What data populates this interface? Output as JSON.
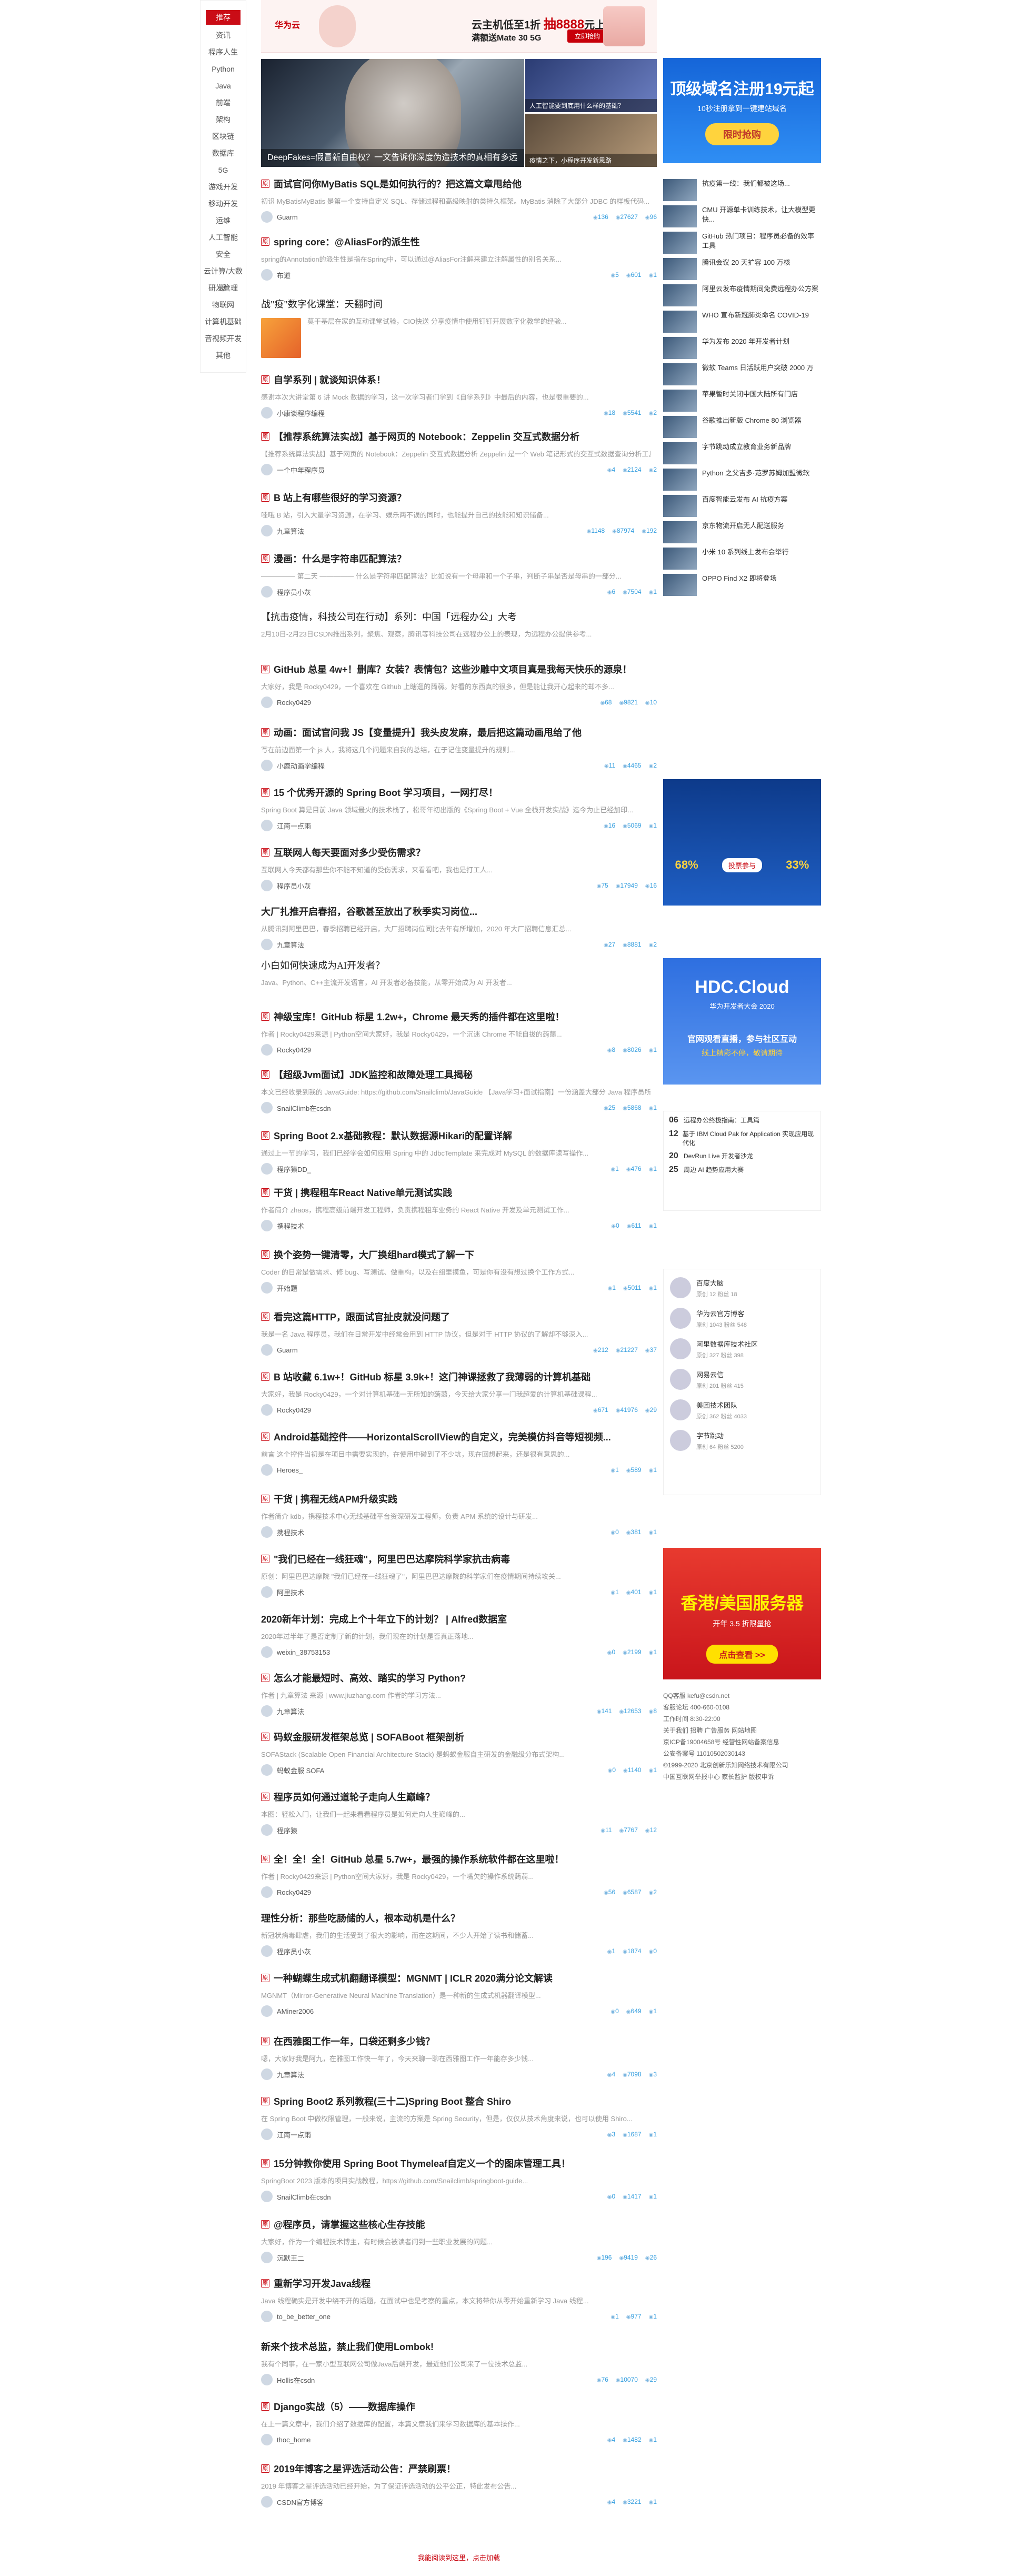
{
  "nav": [
    "推荐",
    "资讯",
    "程序人生",
    "Python",
    "Java",
    "前端",
    "架构",
    "区块链",
    "数据库",
    "5G",
    "游戏开发",
    "移动开发",
    "运维",
    "人工智能",
    "安全",
    "云计算/大数据",
    "研发管理",
    "物联网",
    "计算机基础",
    "音视频开发",
    "其他"
  ],
  "topad": {
    "brand": "华为云",
    "line1_pre": "云主机低至1折",
    "line1_price": "抽8888",
    "line1_post": "元上云礼包",
    "line2": "满额送Mate 30 5G",
    "button": "立即抢购"
  },
  "banner": {
    "main_caption": "DeepFakes=假冒新自由权？一文告诉你深度伪造技术的真相有多远",
    "side1": "人工智能要到底用什么样的基础？",
    "side2": "疫情之下，小程序开发新思路"
  },
  "articles": [
    {
      "title": "面试官问你MyBatis SQL是如何执行的？把这篇文章甩给他",
      "desc": "初识 MyBatisMyBatis 是第一个支持自定义 SQL、存储过程和高级映射的类持久框架。MyBatis 消除了大部分 JDBC 的样板代码...",
      "author": "Guarm",
      "likes": "136",
      "views": "27627",
      "comments": "96"
    },
    {
      "title": "spring core：@AliasFor的派生性",
      "desc": "spring的Annotation的派生性是指在Spring中，可以通过@AliasFor注解来建立注解属性的别名关系...",
      "author": "布道",
      "likes": "5",
      "views": "601",
      "comments": "1"
    },
    {
      "title": "战\"疫\"数字化课堂：天翻时间",
      "desc": "莫干基层在家的互动课堂试验，CIO快送 分享疫情中使用钉钉开展数字化教学的经验...",
      "author": "",
      "likes": "",
      "views": "",
      "comments": ""
    },
    {
      "title": "自学系列 | 就谈知识体系！",
      "desc": "感谢本次大讲堂第 6 讲 Mock 数据的学习，这一次学习者们学到《自学系列》中最后的内容，也是很重要的...",
      "author": "小康谈程序编程",
      "likes": "18",
      "views": "5541",
      "comments": "2"
    },
    {
      "title": "【推荐系统算法实战】基于网页的 Notebook：Zeppelin 交互式数据分析",
      "desc": "【推荐系统算法实战】基于网页的 Notebook：Zeppelin 交互式数据分析 Zeppelin 是一个 Web 笔记形式的交互式数据查询分析工具...",
      "author": "一个中年程序员",
      "likes": "4",
      "views": "2124",
      "comments": "2"
    },
    {
      "title": "B 站上有哪些很好的学习资源？",
      "desc": "哇哦 B 站，引入大量学习资源，在学习、娱乐两不误的同时，也能提升自己的技能和知识储备...",
      "author": "九章算法",
      "likes": "1148",
      "views": "87974",
      "comments": "192"
    },
    {
      "title": "漫画：什么是字符串匹配算法？",
      "desc": "—————  第二天  —————  什么是字符串匹配算法？比如说有一个母串和一个子串，判断子串是否是母串的一部分...",
      "author": "程序员小灰",
      "likes": "6",
      "views": "7504",
      "comments": "1"
    },
    {
      "title": "【抗击疫情，科技公司在行动】系列：中国「远程办公」大考",
      "desc": "2月10日-2月23日CSDN推出系列，聚焦、观察，腾讯等科技公司在远程办公上的表现，为远程办公提供参考...",
      "author": "",
      "likes": "",
      "views": "",
      "comments": ""
    },
    {
      "title": "GitHub 总星 4w+！删库？女装？表情包？这些沙雕中文项目真是我每天快乐的源泉！",
      "desc": "大家好，我是 Rocky0429，一个喜欢在 Github 上瞎逛的蒟蒻。好看的东西真的很多，但是能让我开心起来的却不多...",
      "author": "Rocky0429",
      "likes": "68",
      "views": "9821",
      "comments": "10"
    },
    {
      "title": "动画：面试官问我 JS【变量提升】我头皮发麻，最后把这篇动画甩给了他",
      "desc": "写在前边面第一个 js 人，我将这几个问题来自我的总结，在于记住变量提升的规则...",
      "author": "小鹿动画学编程",
      "likes": "11",
      "views": "4465",
      "comments": "2"
    },
    {
      "title": "15 个优秀开源的 Spring Boot 学习项目，一网打尽！",
      "desc": "Spring Boot 算是目前 Java 领域最火的技术栈了，松哥年初出版的《Spring Boot + Vue 全栈开发实战》迄今为止已经加印...",
      "author": "江南一点雨",
      "likes": "16",
      "views": "5069",
      "comments": "1"
    },
    {
      "title": "互联网人每天要面对多少受伤需求？",
      "desc": "互联网人今天都有那些你不能不知道的受伤需求，来看看吧，我也是打工人...",
      "author": "程序员小灰",
      "likes": "75",
      "views": "17949",
      "comments": "16"
    },
    {
      "title": "大厂扎推开启春招，谷歌甚至放出了秋季实习岗位...",
      "desc": "从腾讯到阿里巴巴，春季招聘已经开启，大厂招聘岗位同比去年有所增加，2020 年大厂招聘信息汇总...",
      "author": "九章算法",
      "likes": "27",
      "views": "8881",
      "comments": "2"
    },
    {
      "title": "小白如何快速成为AI开发者？",
      "desc": "Java、Python、C++主流开发语言，AI 开发者必备技能，从零开始成为 AI 开发者...",
      "author": "",
      "likes": "",
      "views": "",
      "comments": ""
    },
    {
      "title": "神级宝库！GitHub 标星 1.2w+，Chrome 最天秀的插件都在这里啦！",
      "desc": "作者 | Rocky0429来源 | Python空间大家好，我是 Rocky0429，一个沉迷 Chrome 不能自拔的蒟蒻...",
      "author": "Rocky0429",
      "likes": "8",
      "views": "8026",
      "comments": "1"
    },
    {
      "title": "【超级Jvm面试】JDK监控和故障处理工具揭秘",
      "desc": "本文已经收录到我的 JavaGuide: https://github.com/Snailclimb/JavaGuide 【Java学习+面试指南】一份涵盖大部分 Java 程序员所需要掌握的核心知识...",
      "author": "SnailClimb在csdn",
      "likes": "25",
      "views": "5868",
      "comments": "1"
    },
    {
      "title": "Spring Boot 2.x基础教程：默认数据源Hikari的配置详解",
      "desc": "通过上一节的学习，我们已经学会如何应用 Spring 中的 JdbcTemplate 来完成对 MySQL 的数据库读写操作...",
      "author": "程序猿DD_",
      "likes": "1",
      "views": "476",
      "comments": "1"
    },
    {
      "title": "干货 | 携程租车React Native单元测试实践",
      "desc": "作者简介 zhaos，携程高级前端开发工程师，负责携程租车业务的 React Native 开发及单元测试工作...",
      "author": "携程技术",
      "likes": "0",
      "views": "611",
      "comments": "1"
    },
    {
      "title": "换个姿势一键清零，大厂换组hard模式了解一下",
      "desc": "Coder 的日常是做需求、修 bug、写测试、做重构，以及在组里摸鱼，可是你有没有想过换个工作方式...",
      "author": "开始题",
      "likes": "1",
      "views": "5011",
      "comments": "1"
    },
    {
      "title": "看完这篇HTTP，跟面试官扯皮就没问题了",
      "desc": "我是一名 Java 程序员，我们在日常开发中经常会用到 HTTP 协议，但是对于 HTTP 协议的了解却不够深入...",
      "author": "Guarm",
      "likes": "212",
      "views": "21227",
      "comments": "37"
    },
    {
      "title": "B 站收藏 6.1w+！GitHub 标星 3.9k+！这门神课拯救了我薄弱的计算机基础",
      "desc": "大家好，我是 Rocky0429，一个对计算机基础一无所知的蒟蒻，今天给大家分享一门我超爱的计算机基础课程...",
      "author": "Rocky0429",
      "likes": "671",
      "views": "41976",
      "comments": "29"
    },
    {
      "title": "Android基础控件——HorizontalScrollView的自定义，完美模仿抖音等短视频...",
      "desc": "前言 这个控件当初是在项目中需要实现的，在使用中碰到了不少坑，现在回想起来，还是很有意思的...",
      "author": "Heroes_",
      "likes": "1",
      "views": "589",
      "comments": "1"
    },
    {
      "title": "干货 | 携程无线APM升级实践",
      "desc": "作者简介 kdb，携程技术中心无线基础平台资深研发工程师，负责 APM 系统的设计与研发...",
      "author": "携程技术",
      "likes": "0",
      "views": "381",
      "comments": "1"
    },
    {
      "title": "\"我们已经在一线狂魂\"，阿里巴巴达摩院科学家抗击病毒",
      "desc": "原创：阿里巴巴达摩院 \"我们已经在一线狂魂了\"，阿里巴巴达摩院的科学家们在疫情期间持续攻关...",
      "author": "阿里技术",
      "likes": "1",
      "views": "401",
      "comments": "1"
    },
    {
      "title": "2020新年计划：完成上个十年立下的计划？ | Alfred数据室",
      "desc": "2020年过半年了是否定制了新的计划，我们现在的计划是否真正落地...",
      "author": "weixin_38753153",
      "likes": "0",
      "views": "2199",
      "comments": "1"
    },
    {
      "title": "怎么才能最短时、高效、踏实的学习 Python?",
      "desc": "作者 | 九章算法  来源 | www.jiuzhang.com 作者的学习方法...",
      "author": "九章算法",
      "likes": "141",
      "views": "12653",
      "comments": "8"
    },
    {
      "title": "码蚁金服研发框架总览 | SOFABoot 框架剖析",
      "desc": "SOFAStack (Scalable Open Financial Architecture Stack) 是蚂蚁金服自主研发的金融级分布式架构...",
      "author": "蚂蚁金服 SOFA",
      "likes": "0",
      "views": "1140",
      "comments": "1"
    },
    {
      "title": "程序员如何通过道轮子走向人生巅峰？",
      "desc": "本图：轻松入门，让我们一起来看看程序员是如何走向人生巅峰的...",
      "author": "程序猿",
      "likes": "11",
      "views": "7767",
      "comments": "12"
    },
    {
      "title": "全！全！全！GitHub 总星 5.7w+，最强的操作系统软件都在这里啦！",
      "desc": "作者 | Rocky0429来源 | Python空间大家好，我是 Rocky0429，一个嘴欠的操作系统蒟蒻...",
      "author": "Rocky0429",
      "likes": "56",
      "views": "6587",
      "comments": "2"
    },
    {
      "title": "理性分析：那些吃肠储的人，根本动机是什么？",
      "desc": "新冠状病毒肆虐，我们的生活受到了很大的影响，而在这期间，不少人开始了读书和储蓄...",
      "author": "程序员小灰",
      "likes": "1",
      "views": "1874",
      "comments": "0"
    },
    {
      "title": "一种蝴蝶生成式机翻翻译模型：MGNMT | ICLR 2020满分论文解读",
      "desc": "MGNMT（Mirror-Generative Neural Machine Translation）是一种新的生成式机器翻译模型...",
      "author": "AMiner2006",
      "likes": "0",
      "views": "649",
      "comments": "1"
    },
    {
      "title": "在西雅图工作一年，口袋还剩多少钱？",
      "desc": "嗯，大家好我是阿九，在雅图工作快一年了，今天来聊一聊在西雅图工作一年能存多少钱...",
      "author": "九章算法",
      "likes": "4",
      "views": "7098",
      "comments": "3"
    },
    {
      "title": "Spring Boot2 系列教程(三十二)Spring Boot 整合 Shiro",
      "desc": "在 Spring Boot 中做权限管理，一般来说，主流的方案是 Spring Security，但是，仅仅从技术角度来说，也可以使用 Shiro...",
      "author": "江南一点雨",
      "likes": "3",
      "views": "1687",
      "comments": "1"
    },
    {
      "title": "15分钟教你使用 Spring Boot Thymeleaf自定义一个的图床管理工具！",
      "desc": "SpringBoot 2023 版本的项目实战教程，https://github.com/Snailclimb/springboot-guide...",
      "author": "SnailClimb在csdn",
      "likes": "0",
      "views": "1417",
      "comments": "1"
    },
    {
      "title": "@程序员，请掌握这些核心生存技能",
      "desc": "大家好，作为一个编程技术博主，有时候会被读者问到一些职业发展的问题...",
      "author": "沉默王二",
      "likes": "196",
      "views": "9419",
      "comments": "26"
    },
    {
      "title": "重新学习开发Java线程",
      "desc": "Java 线程确实是开发中绕不开的话题，在面试中也是考察的重点，本文将带你从零开始重新学习 Java 线程...",
      "author": "to_be_better_one",
      "likes": "1",
      "views": "977",
      "comments": "1"
    },
    {
      "title": "新来个技术总监，禁止我们使用Lombok!",
      "desc": "我有个同事，在一家小型互联网公司做Java后端开发，最近他们公司来了一位技术总监...",
      "author": "Hollis在csdn",
      "likes": "76",
      "views": "10070",
      "comments": "29"
    },
    {
      "title": "Django实战（5）——数据库操作",
      "desc": "在上一篇文章中，我们介绍了数据库的配置，本篇文章我们来学习数据库的基本操作...",
      "author": "thoc_home",
      "likes": "4",
      "views": "1482",
      "comments": "1"
    },
    {
      "title": "2019年博客之星评选活动公告：严禁刷票！",
      "desc": "2019 年博客之星评选活动已经开始，为了保证评选活动的公平公正，特此发布公告...",
      "author": "CSDN官方博客",
      "likes": "4",
      "views": "3221",
      "comments": "1"
    }
  ],
  "right": {
    "ad1": {
      "h": "顶级域名注册19元起",
      "s": "10秒注册拿到一键建站域名",
      "b": "限时抢购"
    },
    "news": [
      "抗疫第一线：我们都被这场...",
      "CMU 开源单卡训练技术，让大模型更快...",
      "GitHub 热门项目：程序员必备的效率工具",
      "腾讯会议 20 天扩容 100 万核",
      "阿里云发布疫情期间免费远程办公方案",
      "WHO 宣布新冠肺炎命名 COVID-19",
      "华为发布 2020 年开发者计划",
      "微软 Teams 日活跃用户突破 2000 万",
      "苹果暂时关闭中国大陆所有门店",
      "谷歌推出新版 Chrome 80 浏览器",
      "字节跳动成立教育业务新品牌",
      "Python 之父吉多·范罗苏姆加盟微软",
      "百度智能云发布 AI 抗疫方案",
      "京东物流开启无人配送服务",
      "小米 10 系列线上发布会举行",
      "OPPO Find X2 即将登场"
    ],
    "vote": {
      "a": "68%",
      "b": "33%",
      "btn": "投票参与"
    },
    "hdc": {
      "h": "HDC.Cloud",
      "s": "华为开发者大会 2020",
      "c": "官网观看直播，参与社区互动",
      "c2": "线上精彩不停，敬请期待"
    },
    "toplist": [
      [
        "06",
        "远程办公终极指南：工具篇"
      ],
      [
        "12",
        "基于 IBM Cloud Pak for Application 实现应用现代化"
      ],
      [
        "20",
        "DevRun Live 开发者沙龙"
      ],
      [
        "25",
        "周边 AI 趋势应用大赛"
      ]
    ],
    "blogs": [
      [
        "百度大脑",
        "原创 12  粉丝 18"
      ],
      [
        "华为云官方博客",
        "原创 1043  粉丝 548"
      ],
      [
        "阿里数据库技术社区",
        "原创 327  粉丝 398"
      ],
      [
        "网易云信",
        "原创 201  粉丝 415"
      ],
      [
        "美团技术团队",
        "原创 362  粉丝 4033"
      ],
      [
        "字节跳动",
        "原创 64  粉丝 5200"
      ]
    ],
    "ad2": {
      "h": "香港/美国服务器",
      "s": "开年 3.5 折限量抢",
      "b": "点击查看 >>"
    },
    "foot": [
      "QQ客服   kefu@csdn.net",
      "客服论坛   400-660-0108",
      "工作时间 8:30-22:00",
      "关于我们 招聘 广告服务 网站地图",
      "京ICP备19004658号 经营性网站备案信息",
      "公安备案号 11010502030143",
      "©1999-2020 北京创新乐知网络技术有限公司",
      "中国互联网举报中心 家长监护 版权申诉"
    ]
  },
  "bottom_link": "我能阅读到这里，点击加载"
}
